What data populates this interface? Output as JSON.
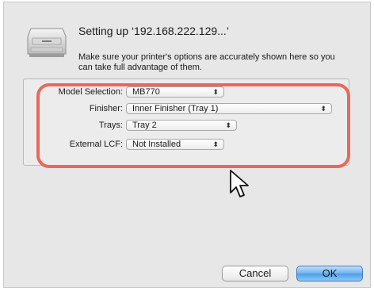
{
  "dialog": {
    "title": "Setting up ‘192.168.222.129...’",
    "description": "Make sure your printer's options are accurately shown here so you can take full advantage of them."
  },
  "options": [
    {
      "label": "Model Selection:",
      "value": "MB770"
    },
    {
      "label": "Finisher:",
      "value": "Inner Finisher (Tray 1)"
    },
    {
      "label": "Trays:",
      "value": "Tray 2"
    },
    {
      "label": "External LCF:",
      "value": "Not Installed"
    }
  ],
  "buttons": {
    "cancel": "Cancel",
    "ok": "OK"
  },
  "colors": {
    "highlight": "#e8695c",
    "primary_button": "#5aa7ec"
  },
  "icons": {
    "printer": "printer-icon",
    "popup_arrows": "updown-arrows-icon",
    "cursor": "mouse-pointer-icon"
  }
}
